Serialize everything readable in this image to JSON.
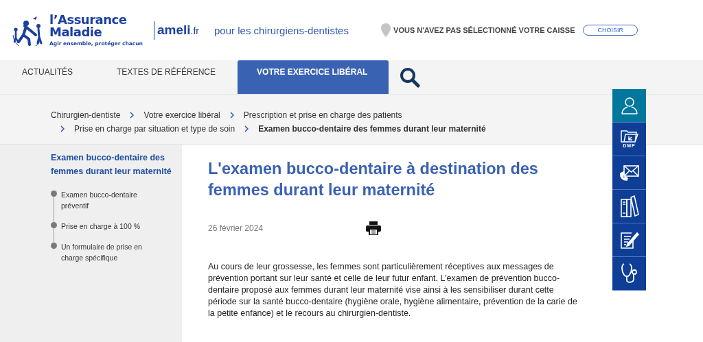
{
  "header": {
    "brand_line1": "l’Assurance",
    "brand_line2": "Maladie",
    "tagline": "Agir ensemble, protéger chacun",
    "site": "ameli",
    "site_suffix": ".fr",
    "audience": "pour les chirurgiens-dentistes",
    "caisse_notice": "VOUS N'AVEZ PAS SÉLECTIONNÉ VOTRE CAISSE",
    "caisse_button": "CHOISIR"
  },
  "nav": {
    "tabs": [
      {
        "label": "ACTUALITÉS",
        "selected": false
      },
      {
        "label": "TEXTES DE RÉFÉRENCE",
        "selected": false
      },
      {
        "label": "VOTRE EXERCICE LIBÉRAL",
        "selected": true
      }
    ]
  },
  "breadcrumb": [
    {
      "label": "Chirurgien-dentiste",
      "current": false
    },
    {
      "label": "Votre exercice libéral",
      "current": false
    },
    {
      "label": "Prescription et prise en charge des patients",
      "current": false
    },
    {
      "label": "Prise en charge par situation et type de soin",
      "current": false
    },
    {
      "label": "Examen bucco-dentaire des femmes durant leur maternité",
      "current": true
    }
  ],
  "sidebar": {
    "title": "Examen bucco-dentaire des femmes durant leur maternité",
    "items": [
      {
        "label": "Examen bucco-dentaire préventif"
      },
      {
        "label": "Prise en charge à 100 %"
      },
      {
        "label": "Un formulaire de prise en charge spécifique"
      }
    ]
  },
  "article": {
    "title": "L'examen bucco-dentaire à destination des femmes durant leur maternité",
    "date": "26 février 2024",
    "body": "Au cours de leur grossesse, les femmes sont particulièrement réceptives aux messages de prévention portant sur leur santé et celle de leur futur enfant. L’examen de prévention bucco-dentaire proposé aux femmes durant leur maternité vise ainsi à les sensibiliser durant cette période sur la santé bucco-dentaire (hygiène orale, hygiène alimentaire, prévention de la carie de la petite enfance) et le recours au chirurgien-dentiste."
  },
  "side_toolbar": [
    {
      "kind": "account",
      "selected": true
    },
    {
      "kind": "dmp",
      "label": "DMP",
      "selected": false
    },
    {
      "kind": "contact",
      "selected": false
    },
    {
      "kind": "library",
      "selected": false
    },
    {
      "kind": "form",
      "selected": false
    },
    {
      "kind": "medical",
      "selected": false
    }
  ]
}
